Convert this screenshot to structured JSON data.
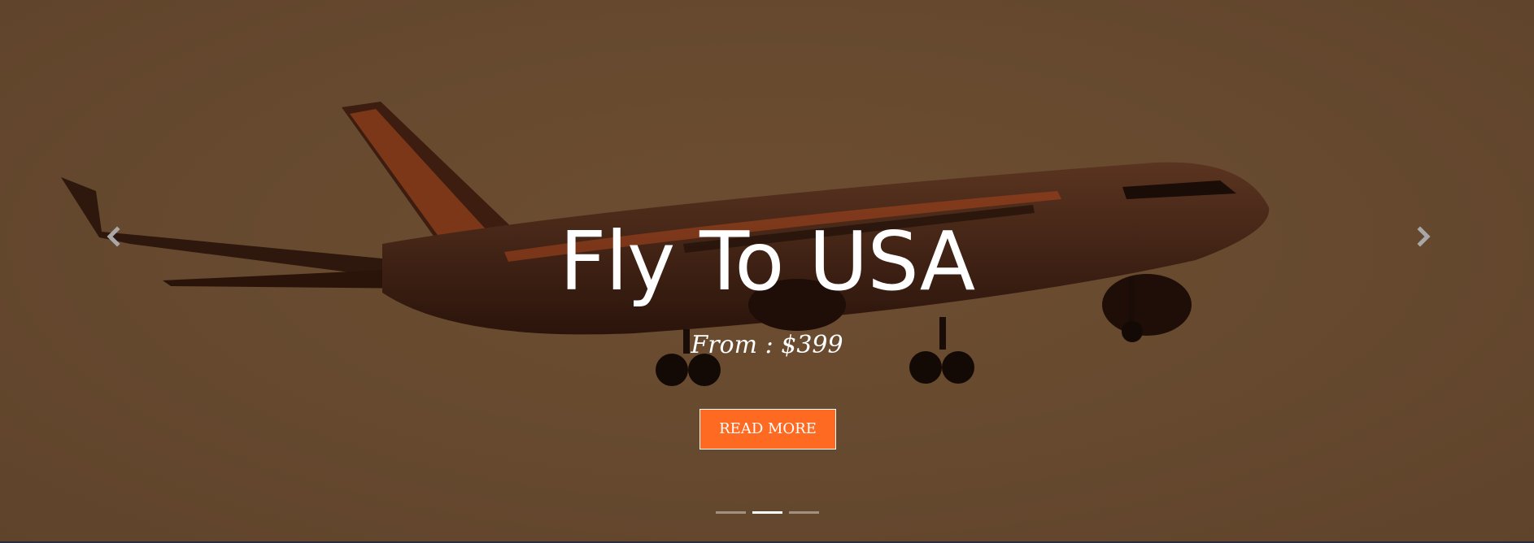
{
  "slide": {
    "title": "Fly To USA",
    "subtitle": "From : $399",
    "button_label": "READ MORE"
  },
  "carousel": {
    "slide_count": 3,
    "active_index": 1,
    "prev_icon": "chevron-left-icon",
    "next_icon": "chevron-right-icon"
  },
  "colors": {
    "overlay_brown": "#674a2f",
    "button_orange": "#ff6a22",
    "text": "#ffffff"
  }
}
